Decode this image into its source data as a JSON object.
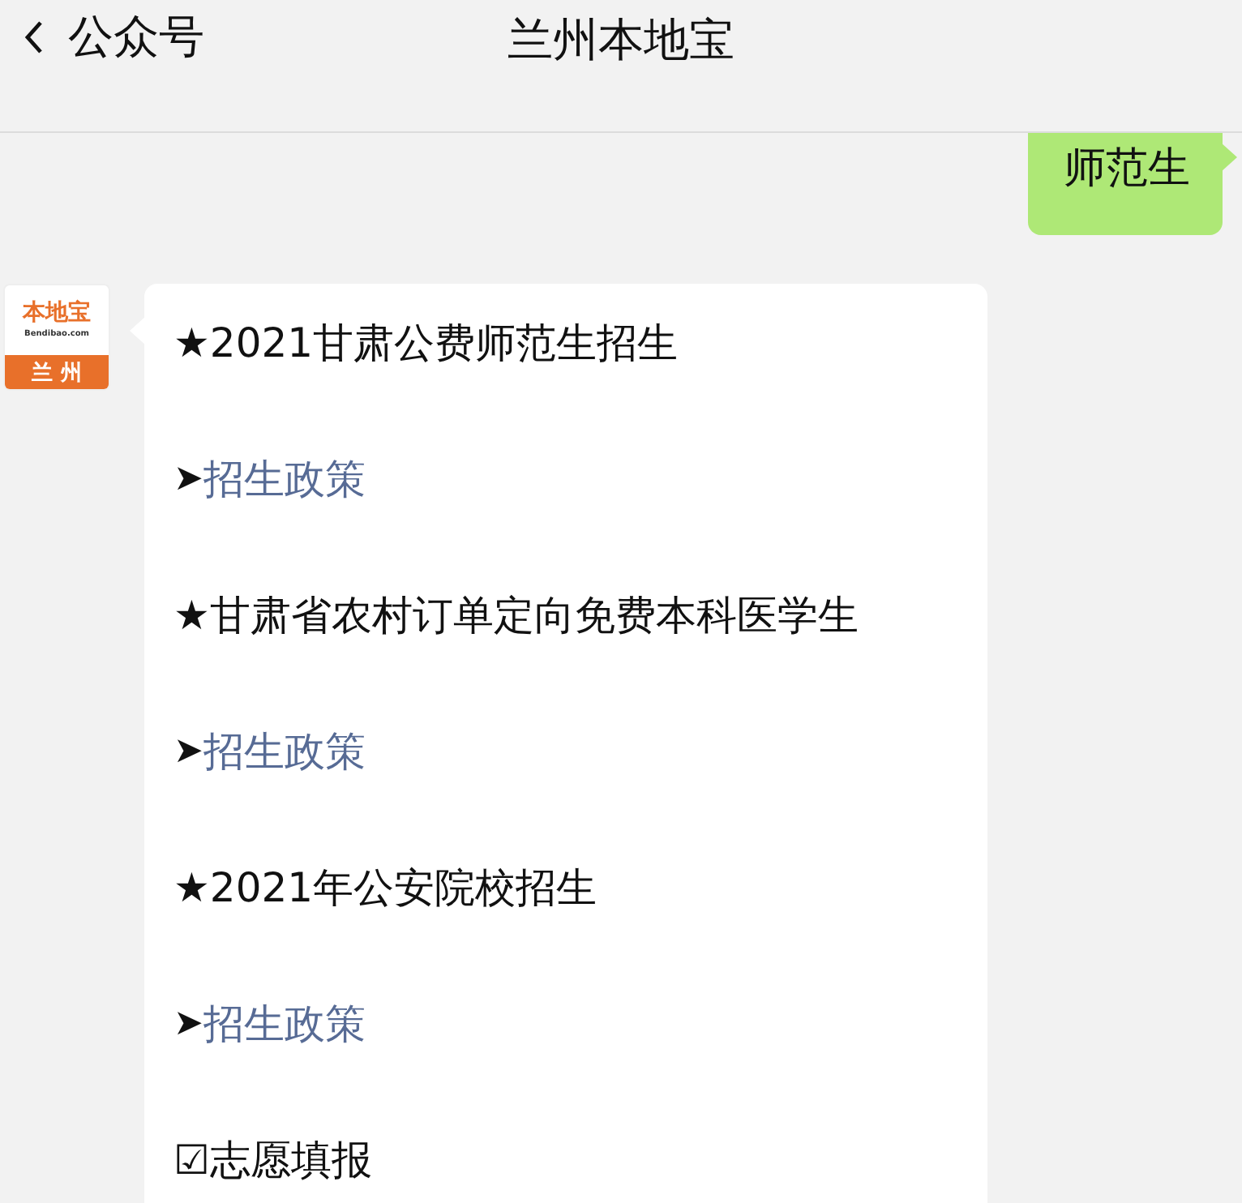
{
  "header": {
    "back_label": "公众号",
    "title": "兰州本地宝"
  },
  "sent_message": {
    "text": "师范生"
  },
  "avatar": {
    "logo_text": "本地宝",
    "site": "Bendibao.com",
    "city": "兰 州"
  },
  "reply_lines": [
    {
      "kind": "text",
      "text": "★2021甘肃公费师范生招生"
    },
    {
      "kind": "link",
      "marker": "➤",
      "text": "招生政策"
    },
    {
      "kind": "text",
      "text": "★甘肃省农村订单定向免费本科医学生"
    },
    {
      "kind": "link",
      "marker": "➤",
      "text": "招生政策"
    },
    {
      "kind": "text",
      "text": "★2021年公安院校招生"
    },
    {
      "kind": "link",
      "marker": "➤",
      "text": "招生政策"
    },
    {
      "kind": "text",
      "text": "☑志愿填报"
    }
  ]
}
